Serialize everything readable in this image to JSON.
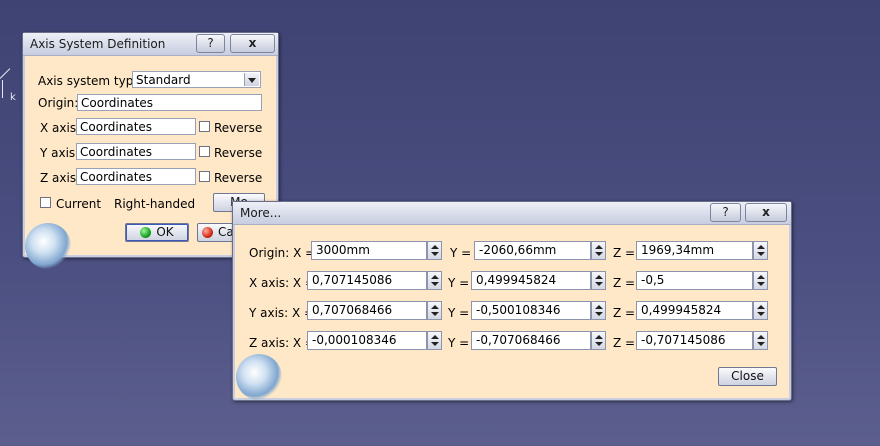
{
  "axis_dialog": {
    "title": "Axis System Definition",
    "help_label": "?",
    "close_label": "x",
    "type_label": "Axis system type:",
    "type_value": "Standard",
    "origin_label": "Origin:",
    "origin_value": "Coordinates",
    "x_axis_label": "X axis:",
    "x_axis_value": "Coordinates",
    "y_axis_label": "Y axis:",
    "y_axis_value": "Coordinates",
    "z_axis_label": "Z axis:",
    "z_axis_value": "Coordinates",
    "reverse_label": "Reverse",
    "current_label": "Current",
    "handedness": "Right-handed",
    "more_button": "Mo",
    "ok_button": "OK",
    "cancel_button": "Ca"
  },
  "more_dialog": {
    "title": "More...",
    "help_label": "?",
    "close_label": "x",
    "rows": [
      {
        "label": "Origin: X =",
        "x": "3000mm",
        "y_label": "Y =",
        "y": "-2060,66mm",
        "z_label": "Z =",
        "z": "1969,34mm"
      },
      {
        "label": "X axis: X =",
        "x": "0,707145086",
        "y_label": "Y =",
        "y": "0,499945824",
        "z_label": "Z =",
        "z": "-0,5"
      },
      {
        "label": "Y axis: X =",
        "x": "0,707068466",
        "y_label": "Y =",
        "y": "-0,500108346",
        "z_label": "Z =",
        "z": "0,499945824"
      },
      {
        "label": "Z axis: X =",
        "x": "-0,000108346",
        "y_label": "Y =",
        "y": "-0,707068466",
        "z_label": "Z =",
        "z": "-0,707145086"
      }
    ],
    "close_button": "Close"
  },
  "viewport": {
    "compass_axis_label": "k"
  }
}
